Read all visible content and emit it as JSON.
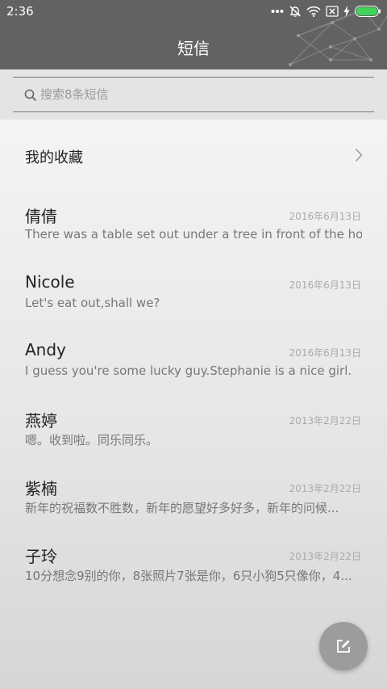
{
  "status_bar": {
    "time": "2:36",
    "icons": [
      "more-dots-icon",
      "bell-off-icon",
      "wifi-icon",
      "no-sim-icon",
      "charging-icon",
      "battery-icon"
    ],
    "battery_color": "#3fd35a"
  },
  "header": {
    "title": "短信"
  },
  "search": {
    "placeholder": "搜索8条短信"
  },
  "favorites": {
    "label": "我的收藏"
  },
  "conversations": [
    {
      "name": "倩倩",
      "date": "2016年6月13日",
      "preview": "There was a table set out under a tree in front of the ho..."
    },
    {
      "name": "Nicole",
      "date": "2016年6月13日",
      "preview": "Let's eat out,shall we?"
    },
    {
      "name": "Andy",
      "date": "2016年6月13日",
      "preview": "I guess you're some lucky guy.Stephanie is a nice girl."
    },
    {
      "name": "燕婷",
      "date": "2013年2月22日",
      "preview": "嗯。收到啦。同乐同乐。"
    },
    {
      "name": "紫楠",
      "date": "2013年2月22日",
      "preview": "新年的祝福数不胜数，新年的愿望好多好多，新年的问候..."
    },
    {
      "name": "子玲",
      "date": "2013年2月22日",
      "preview": "10分想念9别的你，8张照片7张是你，6只小狗5只像你，4..."
    }
  ],
  "fab": {
    "icon": "compose-icon"
  }
}
